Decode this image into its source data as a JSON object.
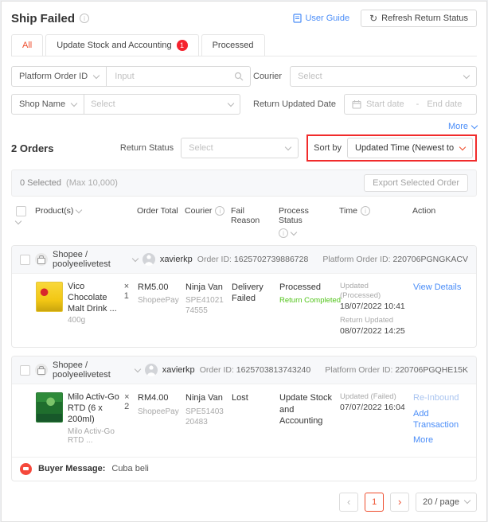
{
  "colors": {
    "accent": "#ee4d2d",
    "link": "#4a8df8",
    "success": "#52c41a",
    "danger": "#f5222d",
    "annotation_box": "#f12b2b"
  },
  "header": {
    "title": "Ship Failed",
    "user_guide": "User Guide",
    "refresh_button": "Refresh Return Status"
  },
  "tabs": [
    {
      "label": "All"
    },
    {
      "label": "Update Stock and Accounting",
      "badge": "1"
    },
    {
      "label": "Processed"
    }
  ],
  "filters": {
    "platform_order_id": {
      "label": "Platform Order ID",
      "placeholder": "Input"
    },
    "courier": {
      "label": "Courier",
      "placeholder": "Select"
    },
    "shop_name": {
      "label": "Shop Name",
      "placeholder": "Select"
    },
    "return_updated_date": {
      "label": "Return Updated Date",
      "start_placeholder": "Start date",
      "separator": "-",
      "end_placeholder": "End date"
    },
    "more_link": "More"
  },
  "toolbar": {
    "orders_count": "2 Orders",
    "return_status_label": "Return Status",
    "return_status_placeholder": "Select",
    "sort_by_label": "Sort by",
    "sort_by_value": "Updated Time (Newest to Old..."
  },
  "selection": {
    "selected_text": "0 Selected",
    "max_text": "(Max 10,000)",
    "export_button": "Export Selected Order"
  },
  "table": {
    "headers": {
      "product": "Product(s)",
      "order_total": "Order Total",
      "courier": "Courier",
      "fail_reason": "Fail Reason",
      "process_status": "Process Status",
      "time": "Time",
      "action": "Action"
    }
  },
  "orders": [
    {
      "shop": "Shopee / poolyeelivetest",
      "buyer": "xavierkp",
      "order_id_label": "Order ID:",
      "order_id": "1625702739886728",
      "platform_order_id_label": "Platform Order ID:",
      "platform_order_id": "220706PGNGKACV",
      "product": {
        "name": "Vico Chocolate Malt Drink ...",
        "variant": "400g",
        "qty": "× 1"
      },
      "order_total": "RM5.00",
      "payment": "ShopeePay",
      "courier": "Ninja Van",
      "tracking_no": "SPE4102174555",
      "fail_reason": "Delivery Failed",
      "process_status": "Processed",
      "process_sub_status": "Return Completed",
      "time_label_1": "Updated (Processed)",
      "time_value_1": "18/07/2022 10:41",
      "time_label_2": "Return Updated",
      "time_value_2": "08/07/2022 14:25",
      "action_1": "View Details"
    },
    {
      "shop": "Shopee / poolyeelivetest",
      "buyer": "xavierkp",
      "order_id_label": "Order ID:",
      "order_id": "1625703813743240",
      "platform_order_id_label": "Platform Order ID:",
      "platform_order_id": "220706PGQHE15K",
      "product": {
        "name": "Milo Activ-Go RTD (6 x 200ml)",
        "variant": "Milo Activ-Go RTD ...",
        "qty": "× 2"
      },
      "order_total": "RM4.00",
      "payment": "ShopeePay",
      "courier": "Ninja Van",
      "tracking_no": "SPE5140320483",
      "fail_reason": "Lost",
      "process_status": "Update Stock and Accounting",
      "time_label_1": "Updated (Failed)",
      "time_value_1": "07/07/2022 16:04",
      "action_1": "Re-Inbound",
      "action_2": "Add Transaction",
      "action_3": "More",
      "buyer_message_label": "Buyer Message:",
      "buyer_message": "Cuba beli"
    }
  ],
  "pagination": {
    "prev": "‹",
    "page": "1",
    "next": "›",
    "page_size": "20 / page"
  }
}
